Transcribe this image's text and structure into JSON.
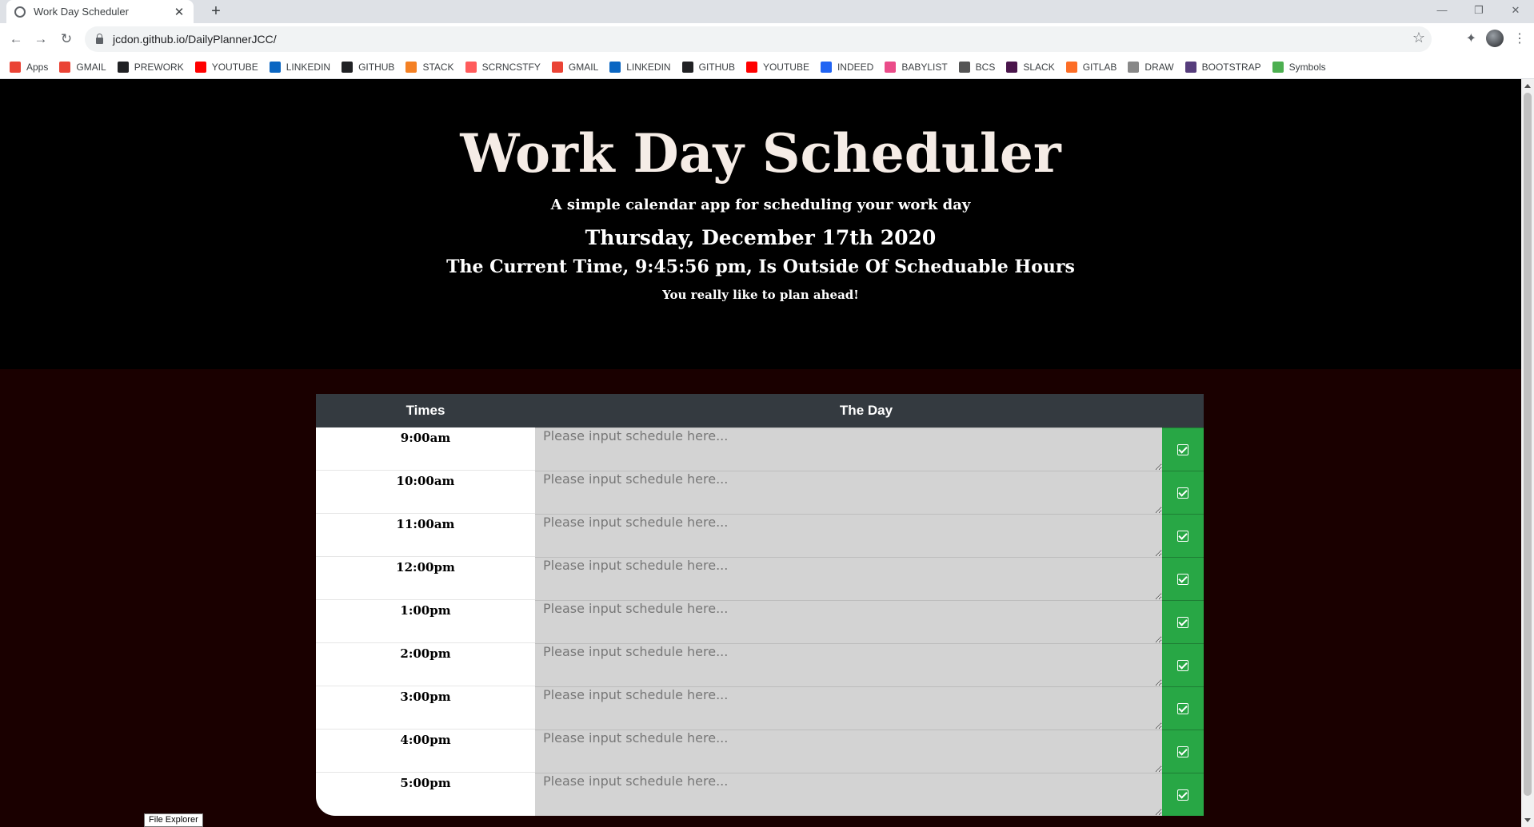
{
  "browser": {
    "tab_title": "Work Day Scheduler",
    "tab_close": "✕",
    "new_tab": "+",
    "url": "jcdon.github.io/DailyPlannerJCC/",
    "window_controls": [
      "—",
      "❐",
      "✕"
    ],
    "nav": {
      "back": "←",
      "forward": "→",
      "reload": "↻"
    },
    "star": "☆",
    "extensions": "✦",
    "menu": "⋮"
  },
  "bookmarks": [
    {
      "label": "Apps",
      "icon": "apps-grid-icon",
      "color": "#ea4335"
    },
    {
      "label": "GMAIL",
      "icon": "gmail-icon",
      "color": "#ea4335"
    },
    {
      "label": "PREWORK",
      "icon": "book-icon",
      "color": "#202124"
    },
    {
      "label": "YOUTUBE",
      "icon": "youtube-icon",
      "color": "#ff0000"
    },
    {
      "label": "LINKEDIN",
      "icon": "linkedin-icon",
      "color": "#0a66c2"
    },
    {
      "label": "GITHUB",
      "icon": "github-icon",
      "color": "#202124"
    },
    {
      "label": "STACK",
      "icon": "stackoverflow-icon",
      "color": "#f48024"
    },
    {
      "label": "SCRNCSTFY",
      "icon": "screencastify-icon",
      "color": "#ff5b5b"
    },
    {
      "label": "GMAIL",
      "icon": "gmail-icon",
      "color": "#ea4335"
    },
    {
      "label": "LINKEDIN",
      "icon": "linkedin-icon",
      "color": "#0a66c2"
    },
    {
      "label": "GITHUB",
      "icon": "github-icon",
      "color": "#202124"
    },
    {
      "label": "YOUTUBE",
      "icon": "youtube-icon",
      "color": "#ff0000"
    },
    {
      "label": "INDEED",
      "icon": "indeed-icon",
      "color": "#2164f3"
    },
    {
      "label": "BABYLIST",
      "icon": "heart-icon",
      "color": "#ea4c89"
    },
    {
      "label": "BCS",
      "icon": "bcs-icon",
      "color": "#555555"
    },
    {
      "label": "SLACK",
      "icon": "slack-icon",
      "color": "#4a154b"
    },
    {
      "label": "GITLAB",
      "icon": "gitlab-icon",
      "color": "#fc6d26"
    },
    {
      "label": "DRAW",
      "icon": "pencil-icon",
      "color": "#888888"
    },
    {
      "label": "BOOTSTRAP",
      "icon": "bootstrap-icon",
      "color": "#563d7c"
    },
    {
      "label": "Symbols",
      "icon": "symbols-icon",
      "color": "#4caf50"
    }
  ],
  "header": {
    "title": "Work Day Scheduler",
    "lead": "A simple calendar app for scheduling your work day",
    "date": "Thursday, December 17th 2020",
    "time_status": "The Current Time, 9:45:56 pm, Is Outside Of Scheduable Hours",
    "note": "You really like to plan ahead!"
  },
  "planner": {
    "col_times": "Times",
    "col_day": "The Day",
    "placeholder": "Please input schedule here...",
    "save_glyph": "☑",
    "hours": [
      {
        "time": "9:00am"
      },
      {
        "time": "10:00am"
      },
      {
        "time": "11:00am"
      },
      {
        "time": "12:00pm"
      },
      {
        "time": "1:00pm"
      },
      {
        "time": "2:00pm"
      },
      {
        "time": "3:00pm"
      },
      {
        "time": "4:00pm"
      },
      {
        "time": "5:00pm"
      }
    ]
  },
  "taskbar_tooltip": "File Explorer"
}
